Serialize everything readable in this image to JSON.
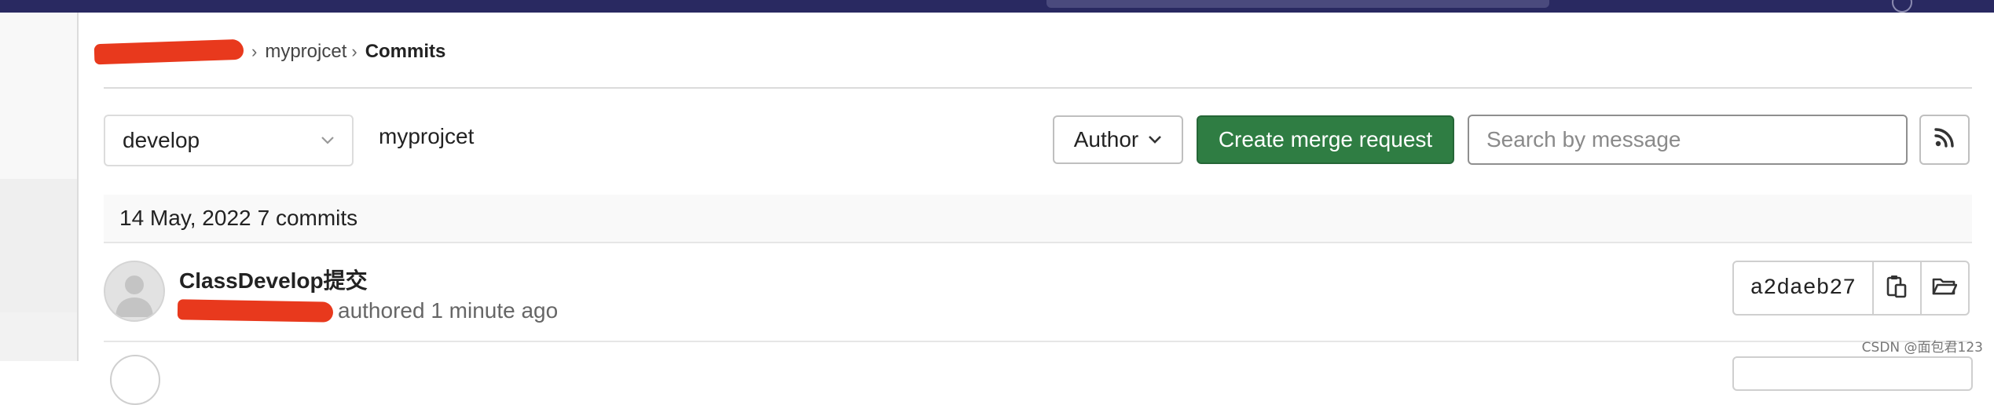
{
  "breadcrumb": {
    "separator": "›",
    "project": "myprojcet",
    "current": "Commits"
  },
  "controls": {
    "branch_value": "develop",
    "path_label": "myprojcet",
    "author_label": "Author",
    "merge_request_label": "Create merge request",
    "search_placeholder": "Search by message"
  },
  "commit_group": {
    "date": "14 May, 2022",
    "count": "7 commits",
    "commits": [
      {
        "title": "ClassDevelop提交",
        "authored": "authored 1 minute ago",
        "sha": "a2daeb27"
      }
    ]
  },
  "watermark": "CSDN @面包君123",
  "colors": {
    "topbar": "#292961",
    "primary_button": "#2f7d43",
    "redaction": "#e8391d"
  },
  "icons": [
    "chevron-down-icon",
    "rss-icon",
    "copy-icon",
    "folder-icon",
    "avatar-placeholder-icon"
  ]
}
